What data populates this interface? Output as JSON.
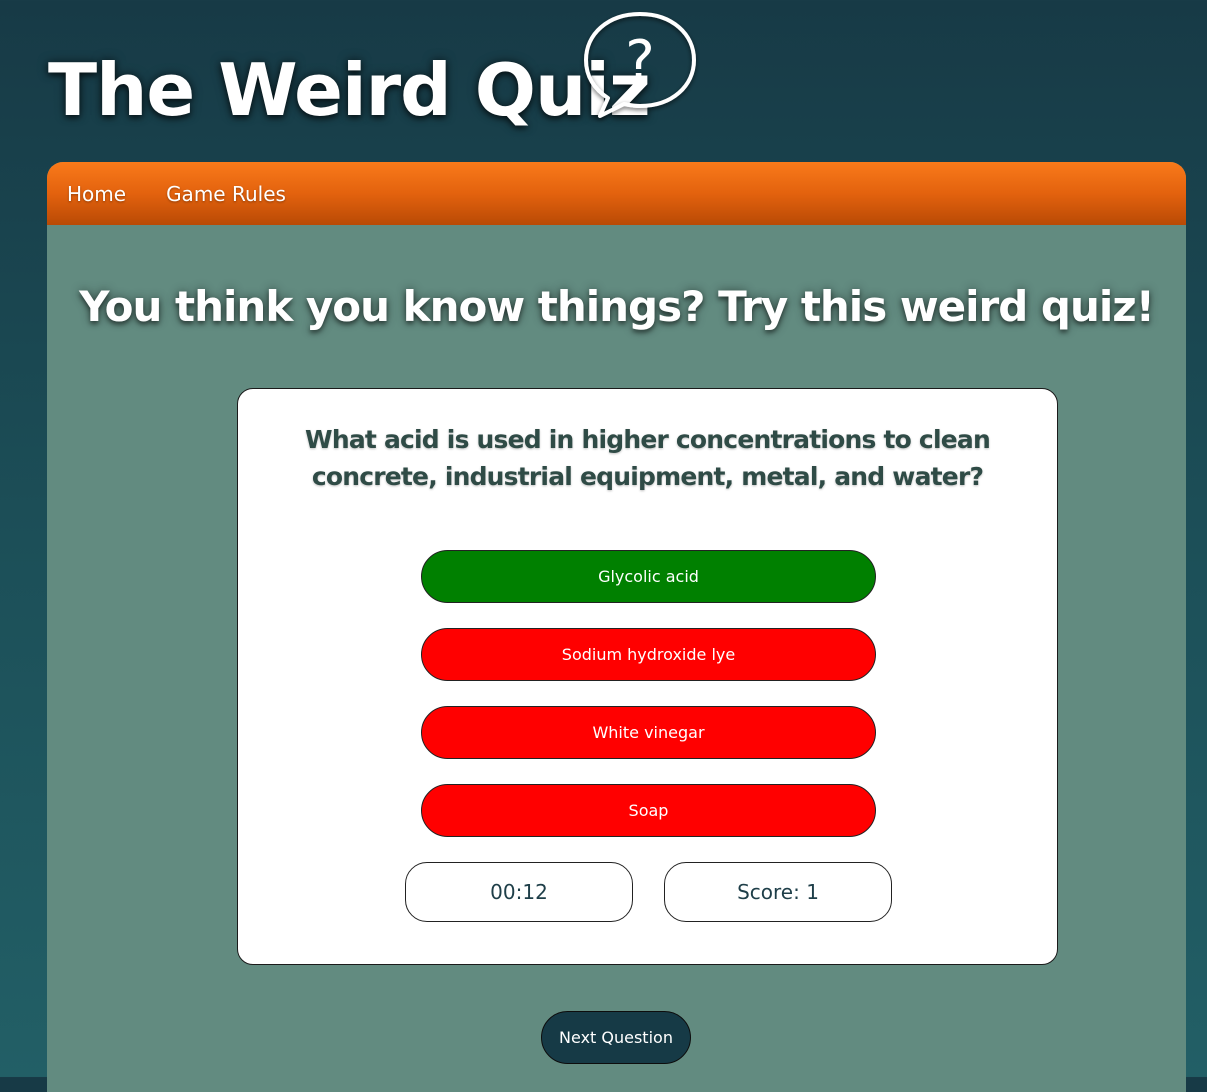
{
  "header": {
    "title": "The Weird Quiz",
    "logo_icon": "question-speech-bubble-icon",
    "logo_symbol": "?"
  },
  "nav": {
    "items": [
      {
        "label": "Home"
      },
      {
        "label": "Game Rules"
      }
    ]
  },
  "main": {
    "heading": "You think you know things? Try this weird quiz!"
  },
  "quiz": {
    "question": "What acid is used in higher concentrations to clean concrete, industrial equipment, metal, and water?",
    "answers": [
      {
        "label": "Glycolic acid",
        "status": "correct",
        "color": "#008000"
      },
      {
        "label": "Sodium hydroxide lye",
        "status": "wrong",
        "color": "#ff0000"
      },
      {
        "label": "White vinegar",
        "status": "wrong",
        "color": "#ff0000"
      },
      {
        "label": "Soap",
        "status": "wrong",
        "color": "#ff0000"
      }
    ],
    "timer": "00:12",
    "score": "Score: 1",
    "next_label": "Next Question"
  },
  "colors": {
    "nav_orange": "#e3620e",
    "panel": "#628b80",
    "next_button": "#163a46",
    "correct": "#008000",
    "wrong": "#ff0000"
  }
}
